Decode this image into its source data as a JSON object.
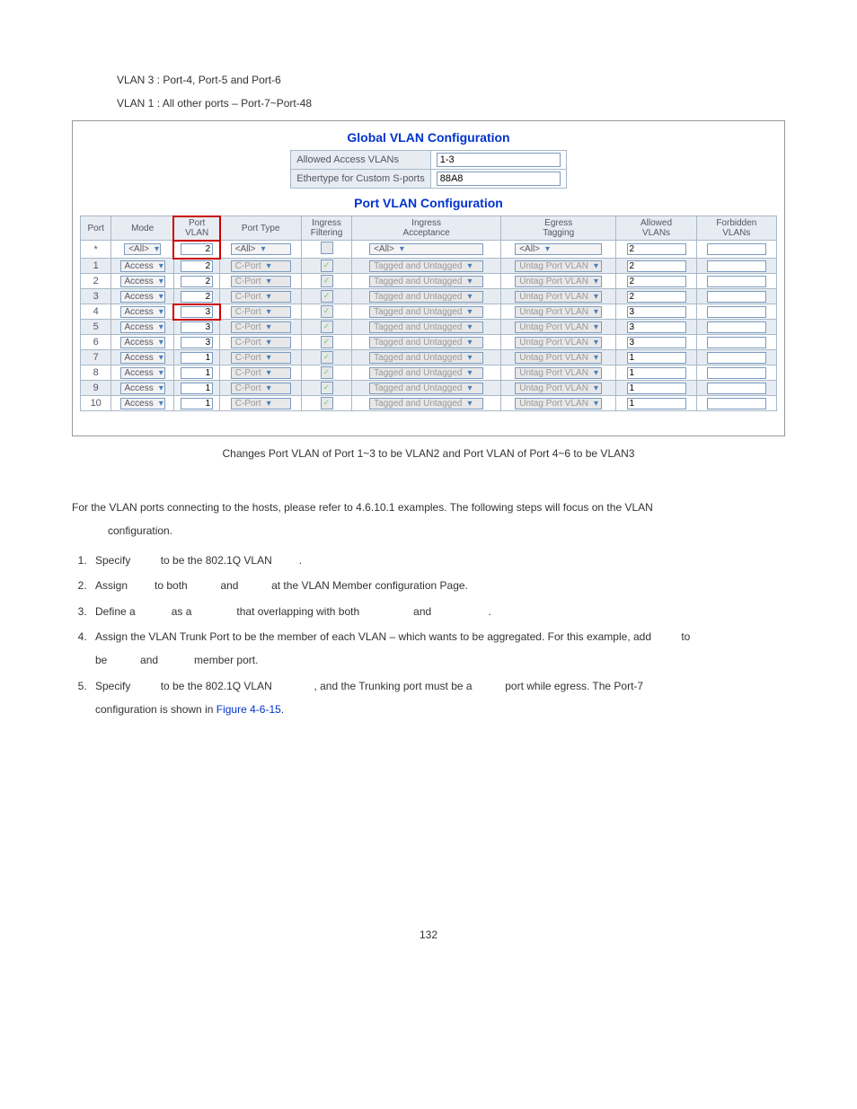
{
  "intro": {
    "line1": "VLAN 3 : Port-4, Port-5 and Port-6",
    "line2": "VLAN 1 : All other ports – Port-7~Port-48"
  },
  "global": {
    "title": "Global VLAN Configuration",
    "rows": [
      {
        "label": "Allowed Access VLANs",
        "value": "1-3"
      },
      {
        "label": "Ethertype for Custom S-ports",
        "value": "88A8"
      }
    ]
  },
  "port_section_title": "Port VLAN Configuration",
  "port_headers": {
    "port": "Port",
    "mode": "Mode",
    "pvlan": "Port\nVLAN",
    "ptype": "Port Type",
    "ifilt": "Ingress\nFiltering",
    "iaccept": "Ingress\nAcceptance",
    "egress": "Egress\nTagging",
    "allowed": "Allowed\nVLANs",
    "forbidden": "Forbidden\nVLANs"
  },
  "port_wildcard": {
    "port": "*",
    "mode": "<All>",
    "pvlan": "2",
    "ptype": "<All>",
    "iaccept": "<All>",
    "egress": "<All>",
    "allowed": "2"
  },
  "port_rows": [
    {
      "port": "1",
      "mode": "Access",
      "pvlan": "2",
      "ptype": "C-Port",
      "ifilt": true,
      "iaccept": "Tagged and Untagged",
      "egress": "Untag Port VLAN",
      "allowed": "2",
      "forbidden": "",
      "hl": false
    },
    {
      "port": "2",
      "mode": "Access",
      "pvlan": "2",
      "ptype": "C-Port",
      "ifilt": true,
      "iaccept": "Tagged and Untagged",
      "egress": "Untag Port VLAN",
      "allowed": "2",
      "forbidden": "",
      "hl": false
    },
    {
      "port": "3",
      "mode": "Access",
      "pvlan": "2",
      "ptype": "C-Port",
      "ifilt": true,
      "iaccept": "Tagged and Untagged",
      "egress": "Untag Port VLAN",
      "allowed": "2",
      "forbidden": "",
      "hl": false
    },
    {
      "port": "4",
      "mode": "Access",
      "pvlan": "3",
      "ptype": "C-Port",
      "ifilt": true,
      "iaccept": "Tagged and Untagged",
      "egress": "Untag Port VLAN",
      "allowed": "3",
      "forbidden": "",
      "hl": true
    },
    {
      "port": "5",
      "mode": "Access",
      "pvlan": "3",
      "ptype": "C-Port",
      "ifilt": true,
      "iaccept": "Tagged and Untagged",
      "egress": "Untag Port VLAN",
      "allowed": "3",
      "forbidden": "",
      "hl": false
    },
    {
      "port": "6",
      "mode": "Access",
      "pvlan": "3",
      "ptype": "C-Port",
      "ifilt": true,
      "iaccept": "Tagged and Untagged",
      "egress": "Untag Port VLAN",
      "allowed": "3",
      "forbidden": "",
      "hl": false
    },
    {
      "port": "7",
      "mode": "Access",
      "pvlan": "1",
      "ptype": "C-Port",
      "ifilt": true,
      "iaccept": "Tagged and Untagged",
      "egress": "Untag Port VLAN",
      "allowed": "1",
      "forbidden": "",
      "hl": false
    },
    {
      "port": "8",
      "mode": "Access",
      "pvlan": "1",
      "ptype": "C-Port",
      "ifilt": true,
      "iaccept": "Tagged and Untagged",
      "egress": "Untag Port VLAN",
      "allowed": "1",
      "forbidden": "",
      "hl": false
    },
    {
      "port": "9",
      "mode": "Access",
      "pvlan": "1",
      "ptype": "C-Port",
      "ifilt": true,
      "iaccept": "Tagged and Untagged",
      "egress": "Untag Port VLAN",
      "allowed": "1",
      "forbidden": "",
      "hl": false
    },
    {
      "port": "10",
      "mode": "Access",
      "pvlan": "1",
      "ptype": "C-Port",
      "ifilt": true,
      "iaccept": "Tagged and Untagged",
      "egress": "Untag Port VLAN",
      "allowed": "1",
      "forbidden": "",
      "hl": false
    }
  ],
  "caption": "Changes Port VLAN of Port 1~3 to be VLAN2 and Port VLAN of Port 4~6 to be VLAN3",
  "body": {
    "lead": "For the VLAN ports connecting to the hosts, please refer to 4.6.10.1 examples. The following steps will focus on the VLAN",
    "lead2": "configuration.",
    "step1": "Specify          to be the 802.1Q VLAN         .",
    "step2": "Assign         to both           and           at the VLAN Member configuration Page.",
    "step3": "Define a            as a               that overlapping with both                  and                   .",
    "step4a": "Assign the VLAN Trunk Port to be the member of each VLAN – which wants to be aggregated. For this example, add          to",
    "step4b": "be           and            member port.",
    "step5a": "Specify          to be the 802.1Q VLAN              , and the Trunking port must be a           port while egress. The Port-7",
    "step5b": "configuration is shown in ",
    "figref": "Figure 4-6-15."
  },
  "page_number": "132"
}
